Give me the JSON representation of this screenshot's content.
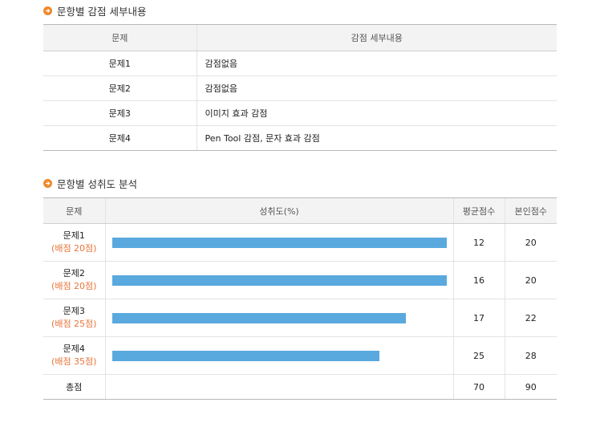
{
  "deductions": {
    "title": "문항별 감점 세부내용",
    "headers": [
      "문제",
      "감점 세부내용"
    ],
    "rows": [
      {
        "q": "문제1",
        "detail": "감점없음"
      },
      {
        "q": "문제2",
        "detail": "감점없음"
      },
      {
        "q": "문제3",
        "detail": "이미지 효과 감점"
      },
      {
        "q": "문제4",
        "detail": "Pen Tool 감점, 문자 효과 감점"
      }
    ]
  },
  "achievement": {
    "title": "문항별 성취도 분석",
    "headers": [
      "문제",
      "성취도(%)",
      "평균점수",
      "본인점수"
    ],
    "rows": [
      {
        "q": "문제1",
        "sub": "(배점 20점)",
        "pct": 100,
        "avg": "12",
        "mine": "20"
      },
      {
        "q": "문제2",
        "sub": "(배점 20점)",
        "pct": 100,
        "avg": "16",
        "mine": "20"
      },
      {
        "q": "문제3",
        "sub": "(배점 25점)",
        "pct": 88,
        "avg": "17",
        "mine": "22"
      },
      {
        "q": "문제4",
        "sub": "(배점 35점)",
        "pct": 80,
        "avg": "25",
        "mine": "28"
      }
    ],
    "total": {
      "label": "총점",
      "avg": "70",
      "mine": "90"
    }
  },
  "colors": {
    "accent": "#f0882a",
    "bar": "#59a9de",
    "sub_text": "#e8743b"
  }
}
